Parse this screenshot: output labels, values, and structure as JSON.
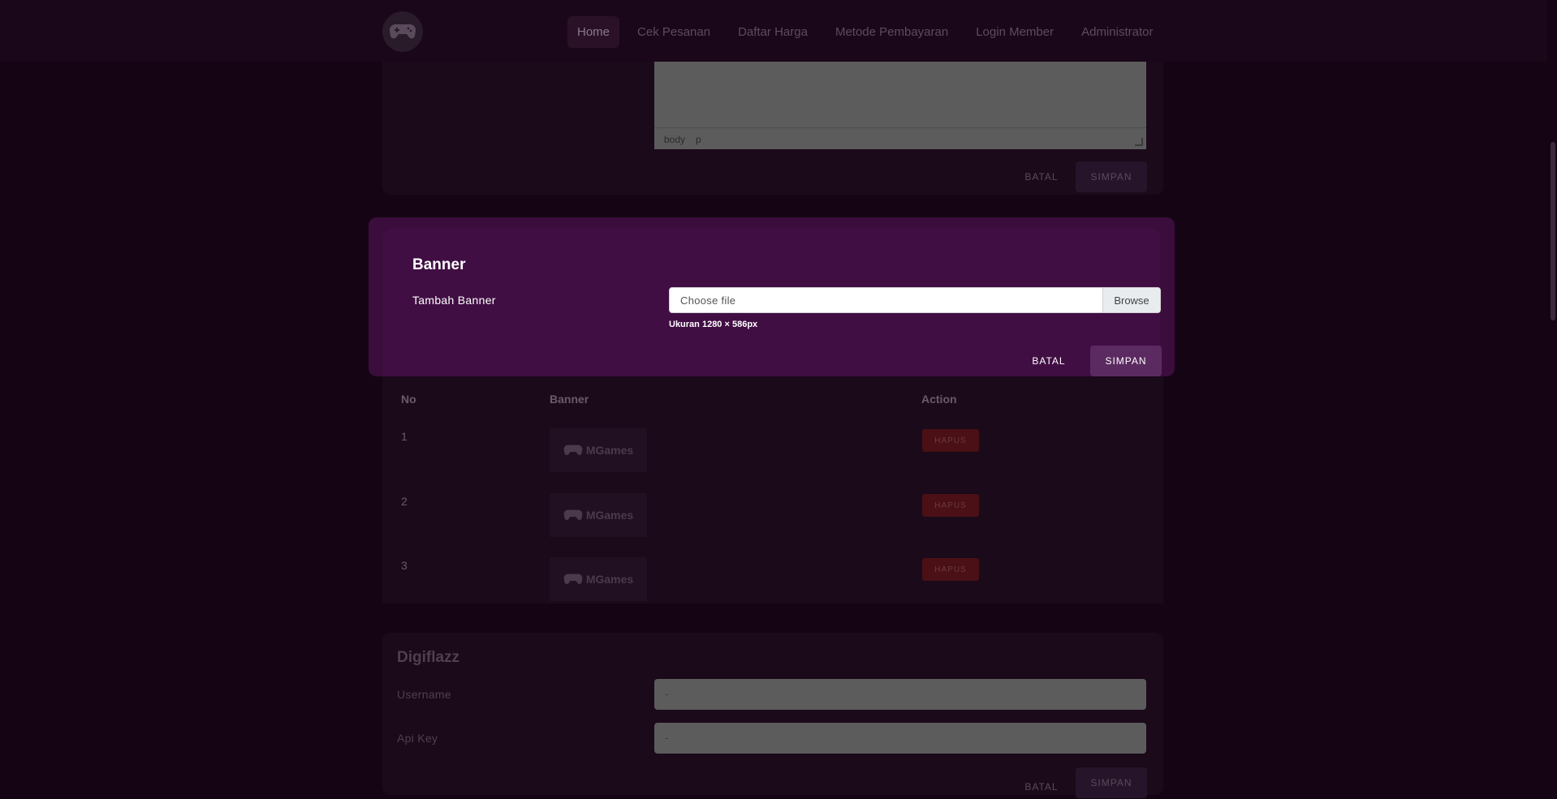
{
  "nav": {
    "logo_icon": "gamepad-icon",
    "items": [
      "Home",
      "Cek Pesanan",
      "Daftar Harga",
      "Metode Pembayaran",
      "Login Member",
      "Administrator"
    ],
    "active": "Home"
  },
  "editor": {
    "status_body": "body",
    "status_p": "p"
  },
  "top_actions": {
    "cancel": "BATAL",
    "save": "SIMPAN"
  },
  "banner_form": {
    "title": "Banner",
    "label": "Tambah Banner",
    "file_placeholder": "Choose file",
    "browse": "Browse",
    "hint": "Ukuran 1280 × 586px",
    "cancel": "BATAL",
    "save": "SIMPAN"
  },
  "banner_table": {
    "columns": [
      "No",
      "Banner",
      "Action"
    ],
    "rows": [
      {
        "no": "1",
        "image_text": "MGames",
        "action": "HAPUS"
      },
      {
        "no": "2",
        "image_text": "MGames",
        "action": "HAPUS"
      },
      {
        "no": "3",
        "image_text": "MGames",
        "action": "HAPUS"
      }
    ]
  },
  "digiflazz": {
    "title": "Digiflazz",
    "username_label": "Username",
    "username_value": "-",
    "apikey_label": "Api Key",
    "apikey_value": "-",
    "cancel": "BATAL",
    "save": "SIMPAN"
  },
  "colors": {
    "accent": "#410e44",
    "danger": "#4a1016",
    "background": "#150514"
  }
}
